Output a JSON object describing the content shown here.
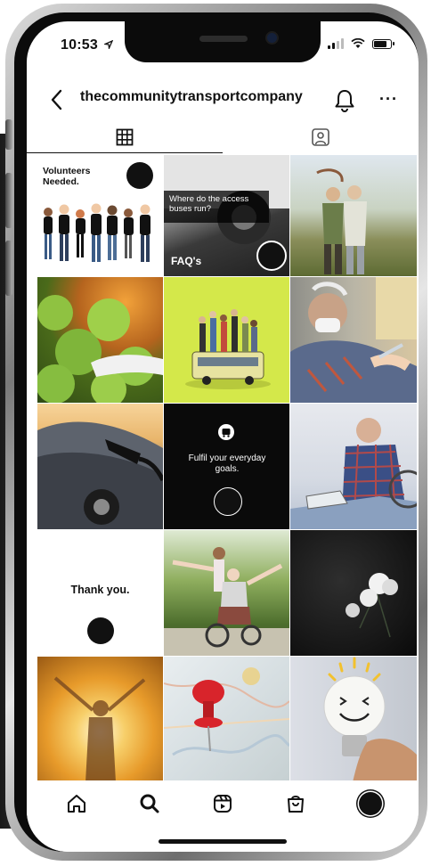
{
  "status_bar": {
    "time": "10:53",
    "location_arrow": "location-arrow-icon",
    "signal": "signal-icon",
    "wifi": "wifi-icon",
    "battery": "battery-icon"
  },
  "header": {
    "username": "thecommunitytransportcompany",
    "back_icon": "chevron-left-icon",
    "bell_icon": "bell-icon",
    "more_label": "···"
  },
  "tabs": [
    {
      "icon": "grid-icon",
      "active": true
    },
    {
      "icon": "tagged-person-icon",
      "active": false
    }
  ],
  "posts": [
    {
      "heading": "Volunteers Needed.",
      "badge": "The Community Transport"
    },
    {
      "caption": "Where do the access buses run?",
      "footer": "FAQ's",
      "badge": "The Community Transport"
    },
    {
      "image": "elderly-couple-walking"
    },
    {
      "image": "green-apples"
    },
    {
      "image": "toy-bus-with-people"
    },
    {
      "image": "man-receiving-vaccine"
    },
    {
      "image": "car-charging"
    },
    {
      "caption": "Fulfil your everyday goals.",
      "badge": "The Community Transport",
      "icon": "bus-stop-icon"
    },
    {
      "image": "man-in-wheelchair-ironing"
    },
    {
      "text": "Thank you.",
      "badge": "The Community Transport"
    },
    {
      "image": "woman-in-wheelchair-park"
    },
    {
      "image": "white-flowers-dark"
    },
    {
      "image": "woman-in-sunlight"
    },
    {
      "image": "map-pins"
    },
    {
      "image": "smiling-lightbulb"
    }
  ],
  "bottom_nav": [
    {
      "icon": "home-icon"
    },
    {
      "icon": "search-icon"
    },
    {
      "icon": "reels-icon"
    },
    {
      "icon": "shop-icon"
    },
    {
      "icon": "profile-avatar-icon"
    }
  ],
  "colors": {
    "tile_green": "#d4e84a",
    "tile_black": "#0a0a0a",
    "pin_red": "#d8242b"
  }
}
